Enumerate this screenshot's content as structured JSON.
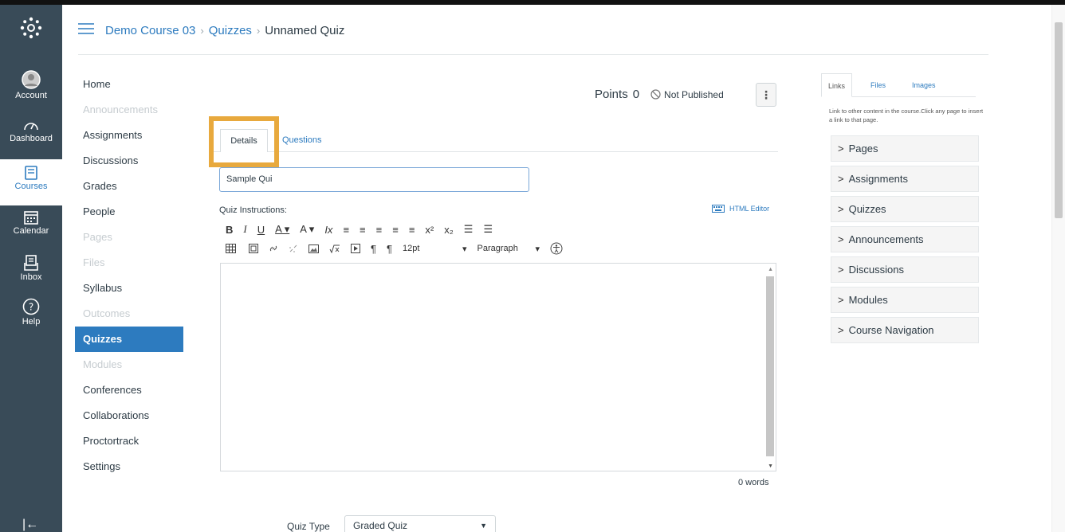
{
  "global_nav": {
    "items": [
      {
        "label": "",
        "icon": "logo-icon"
      },
      {
        "label": "Account",
        "icon": "avatar-icon"
      },
      {
        "label": "Dashboard",
        "icon": "dashboard-icon"
      },
      {
        "label": "Courses",
        "icon": "courses-icon",
        "active": true
      },
      {
        "label": "Calendar",
        "icon": "calendar-icon"
      },
      {
        "label": "Inbox",
        "icon": "inbox-icon"
      },
      {
        "label": "Help",
        "icon": "help-icon"
      }
    ],
    "collapse_glyph": "|←"
  },
  "breadcrumb": {
    "course": "Demo Course 03",
    "section": "Quizzes",
    "current": "Unnamed Quiz",
    "separator": "›"
  },
  "course_nav": {
    "items": [
      {
        "label": "Home",
        "state": "normal"
      },
      {
        "label": "Announcements",
        "state": "dim"
      },
      {
        "label": "Assignments",
        "state": "normal"
      },
      {
        "label": "Discussions",
        "state": "normal"
      },
      {
        "label": "Grades",
        "state": "normal"
      },
      {
        "label": "People",
        "state": "normal"
      },
      {
        "label": "Pages",
        "state": "dim"
      },
      {
        "label": "Files",
        "state": "dim"
      },
      {
        "label": "Syllabus",
        "state": "normal"
      },
      {
        "label": "Outcomes",
        "state": "dim"
      },
      {
        "label": "Quizzes",
        "state": "active"
      },
      {
        "label": "Modules",
        "state": "dim"
      },
      {
        "label": "Conferences",
        "state": "normal"
      },
      {
        "label": "Collaborations",
        "state": "normal"
      },
      {
        "label": "Proctortrack",
        "state": "normal"
      },
      {
        "label": "Settings",
        "state": "normal"
      }
    ]
  },
  "quiz": {
    "points_label": "Points",
    "points_value": "0",
    "publish_status": "Not Published",
    "kebab": "⋮",
    "tabs": {
      "details": "Details",
      "questions": "Questions"
    },
    "title_value": "Sample Qui",
    "instructions_label": "Quiz Instructions:",
    "html_editor_label": "HTML Editor",
    "font_size": "12pt",
    "block_format": "Paragraph",
    "word_count": "0 words",
    "quiz_type_label": "Quiz Type",
    "quiz_type_value": "Graded Quiz"
  },
  "toolbar_row1": [
    "B",
    "I",
    "U",
    "A ▾",
    "A ▾",
    "Ix",
    "≡",
    "≡",
    "≡",
    "≡",
    "≡",
    "x²",
    "x₂",
    "☰",
    "☰"
  ],
  "right_sidebar": {
    "tabs": [
      "Links",
      "Files",
      "Images"
    ],
    "help_text": "Link to other content in the course.Click any page to insert a link to that page.",
    "items": [
      "Pages",
      "Assignments",
      "Quizzes",
      "Announcements",
      "Discussions",
      "Modules",
      "Course Navigation"
    ]
  },
  "colors": {
    "nav_bg": "#394b58",
    "link": "#2d7bbf",
    "highlight": "#e8a93d",
    "active_nav": "#2d7bbf"
  }
}
